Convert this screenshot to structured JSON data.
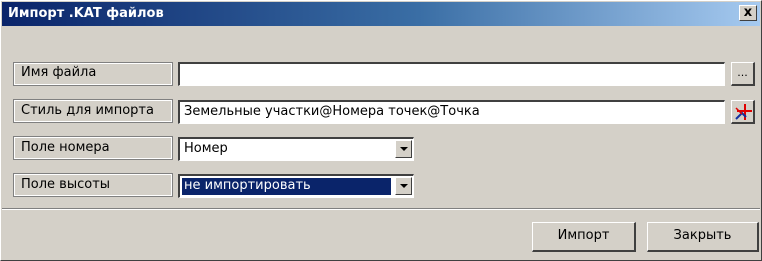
{
  "window": {
    "title": "Импорт .KAT файлов",
    "close_glyph": "x"
  },
  "fields": {
    "filename": {
      "label": "Имя файла",
      "value": "",
      "browse_label": "..."
    },
    "style": {
      "label": "Стиль для импорта",
      "value": "Земельные участки@Номера точек@Точка",
      "pick_icon": "style-picker-icon"
    },
    "number_field": {
      "label": "Поле номера",
      "value": "Номер"
    },
    "height_field": {
      "label": "Поле высоты",
      "value": "не импортировать"
    }
  },
  "buttons": {
    "import": "Импорт",
    "close": "Закрыть"
  },
  "colors": {
    "title_start": "#0a246a",
    "title_end": "#a6caf0",
    "face": "#d4d0c8",
    "selection": "#0a246a",
    "icon_red": "#e00000",
    "icon_blue": "#1030a0"
  }
}
